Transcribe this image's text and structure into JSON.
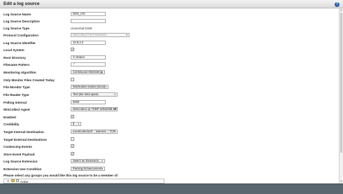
{
  "dialog": {
    "title": "Edit a log source",
    "help_icon_glyph": "?"
  },
  "form": {
    "log_source_name": {
      "label": "Log Source Name",
      "value": "DNS_IVC"
    },
    "log_source_description": {
      "label": "Log Source Description",
      "value": ""
    },
    "log_source_type": {
      "label": "Log Source Type",
      "value": "Universal DSM"
    },
    "protocol_configuration": {
      "label": "Protocol Configuration",
      "value": "WinCollect File Forwarder"
    },
    "log_source_identifier": {
      "label": "Log Source Identifier",
      "value": "10.8.2.2"
    },
    "local_system": {
      "label": "Local System",
      "checked": true
    },
    "root_directory": {
      "label": "Root Directory",
      "value": "C:\\share\\"
    },
    "filename_pattern": {
      "label": "Filename Pattern",
      "value": ".*"
    },
    "monitoring_algorithm": {
      "label": "Monitoring Algorithm",
      "value": "Continuous Monitoring"
    },
    "only_monitor_files_created_today": {
      "label": "Only Monitor Files Created Today",
      "checked": false
    },
    "file_monitor_type": {
      "label": "File Monitor Type",
      "value": "Notification-based (local)"
    },
    "file_reader_type": {
      "label": "File Reader Type",
      "value": "Text (file held open)"
    },
    "polling_interval": {
      "label": "Polling Interval",
      "value": "5000"
    },
    "wincollect_agent": {
      "label": "WinCollect Agent",
      "value": "WinCollect @ TEBP-WIN2008-MP"
    },
    "enabled": {
      "label": "Enabled",
      "checked": true
    },
    "credibility": {
      "label": "Credibility",
      "value": "5"
    },
    "target_internal_destination": {
      "label": "Target Internal Destination",
      "value": "eventcollector0 :: siemere :: TCP"
    },
    "target_external_destinations": {
      "label": "Target External Destinations",
      "checked": false
    },
    "coalescing_events": {
      "label": "Coalescing Events",
      "checked": true
    },
    "store_event_payload": {
      "label": "Store Event Payload",
      "checked": true
    },
    "log_source_extension": {
      "label": "Log Source Extension",
      "value": "Select an Extension..."
    },
    "extension_use_condition": {
      "label": "Extension Use Condition",
      "value": "Parsing Enhancement"
    },
    "group_prompt": "Please select any groups you would like this log source to be a member of:",
    "groups": [
      {
        "label": "Active",
        "checked": false
      }
    ]
  },
  "checkbox_glyph": "✓",
  "dropdown_glyph": "▾",
  "colors": {
    "title_bar_bg": "#dcdcdc",
    "help_icon": "#2f5fa8",
    "footer_bg": "#5a6771",
    "folder_icon": "#e6c25a"
  }
}
